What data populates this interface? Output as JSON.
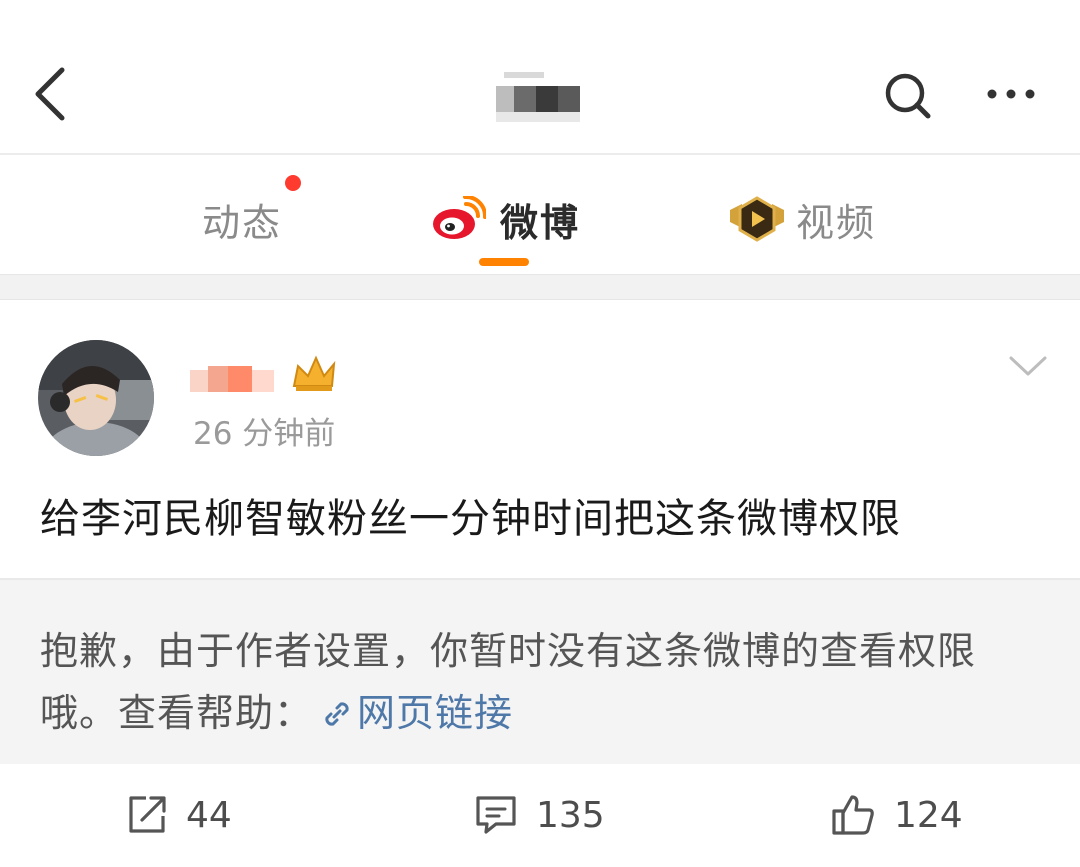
{
  "tabs": {
    "dynamic": "动态",
    "weibo": "微博",
    "video": "视频"
  },
  "post": {
    "time": "26 分钟前",
    "text": "给李河民柳智敏粉丝一分钟时间把这条微博权限"
  },
  "notice": {
    "message": "抱歉，由于作者设置，你暂时没有这条微博的查看权限哦。查看帮助：",
    "link_label": "网页链接"
  },
  "actions": {
    "reposts": "44",
    "comments": "135",
    "likes": "124"
  },
  "icons": {
    "back": "chevron-left-icon",
    "search": "search-icon",
    "more": "more-dots-icon",
    "weibo_logo": "weibo-logo-icon",
    "video_badge": "video-badge-icon",
    "expand": "chevron-down-icon",
    "link": "link-icon",
    "repost": "repost-icon",
    "comment": "comment-icon",
    "like": "thumbs-up-icon"
  },
  "colors": {
    "accent": "#ff8200",
    "notification_dot": "#ff3b30",
    "link": "#4e78a8"
  }
}
